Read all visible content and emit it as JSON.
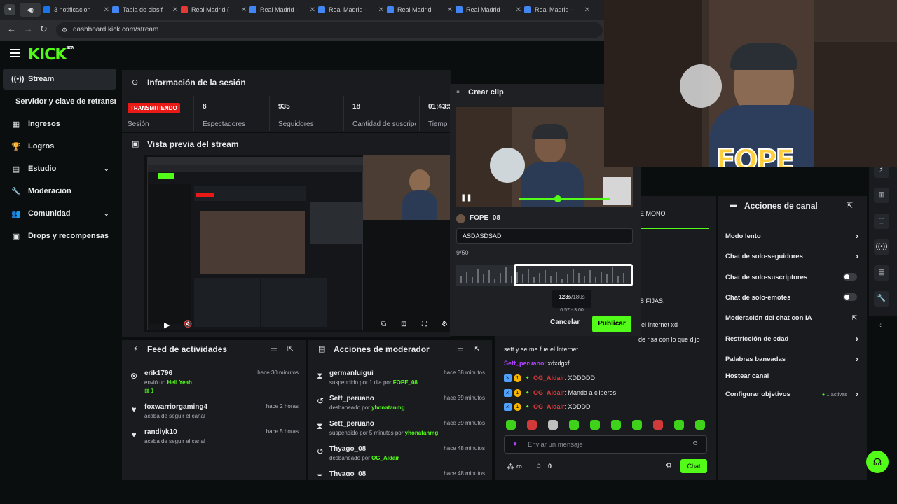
{
  "browser": {
    "tabs": [
      {
        "label": "3 notificacion",
        "color": "#1a73e8"
      },
      {
        "label": "Tabla de clasif",
        "color": "#4285f4"
      },
      {
        "label": "Real Madrid (",
        "color": "#e53935"
      },
      {
        "label": "Real Madrid -",
        "color": "#4285f4"
      },
      {
        "label": "Real Madrid -",
        "color": "#4285f4"
      },
      {
        "label": "Real Madrid -",
        "color": "#4285f4"
      },
      {
        "label": "Real Madrid -",
        "color": "#4285f4"
      },
      {
        "label": "Real Madrid -",
        "color": "#4285f4"
      }
    ],
    "url": "dashboard.kick.com/stream"
  },
  "header": {
    "logo": "KICK",
    "beta": "BETA"
  },
  "sidebar": {
    "items": [
      {
        "label": "Stream",
        "icon": "broadcast-icon"
      },
      {
        "label": "Servidor y clave de retransmisión",
        "icon": ""
      },
      {
        "label": "Ingresos",
        "icon": "chart-icon"
      },
      {
        "label": "Logros",
        "icon": "trophy-icon"
      },
      {
        "label": "Estudio",
        "icon": "layout-icon"
      },
      {
        "label": "Moderación",
        "icon": "wrench-icon"
      },
      {
        "label": "Comunidad",
        "icon": "people-icon"
      },
      {
        "label": "Drops y recompensas",
        "icon": "gift-icon"
      }
    ]
  },
  "session": {
    "title": "Información de la sesión",
    "status_badge": "TRANSMITIENDO",
    "status_label": "Sesión",
    "stats": [
      {
        "value": "8",
        "label": "Espectadores"
      },
      {
        "value": "935",
        "label": "Seguidores"
      },
      {
        "value": "18",
        "label": "Cantidad de suscripciones"
      },
      {
        "value": "01:43:5",
        "label": "Tiemp"
      }
    ]
  },
  "preview": {
    "title": "Vista previa del stream"
  },
  "activity": {
    "title": "Feed de actividades",
    "items": [
      {
        "icon": "kick-icon",
        "name": "erik1796",
        "time": "hace 30 minutos",
        "desc": "envió un",
        "highlight": "Hell Yeah",
        "extra": "1"
      },
      {
        "icon": "heart-icon",
        "name": "foxwarriorgaming4",
        "time": "hace 2 horas",
        "desc": "acaba de seguir el canal",
        "highlight": "",
        "extra": ""
      },
      {
        "icon": "heart-icon",
        "name": "randiyk10",
        "time": "hace 5 horas",
        "desc": "acaba de seguir el canal",
        "highlight": "",
        "extra": ""
      }
    ]
  },
  "mod_actions": {
    "title": "Acciones de moderador",
    "items": [
      {
        "icon": "hourglass-icon",
        "name": "germanluigui",
        "time": "hace 38 minutos",
        "desc": "suspendido por 1 día por",
        "by": "FOPE_08"
      },
      {
        "icon": "undo-icon",
        "name": "Sett_peruano",
        "time": "hace 39 minutos",
        "desc": "desbaneado por",
        "by": "yhonatanmg"
      },
      {
        "icon": "hourglass-icon",
        "name": "Sett_peruano",
        "time": "hace 39 minutos",
        "desc": "suspendido por 5 minutos por",
        "by": "yhonatanmg"
      },
      {
        "icon": "undo-icon",
        "name": "Thyago_08",
        "time": "hace 48 minutos",
        "desc": "desbaneado por",
        "by": "OG_Aldair"
      },
      {
        "icon": "hourglass-icon",
        "name": "Thyago_08",
        "time": "hace 48 minutos",
        "desc": "",
        "by": ""
      }
    ]
  },
  "clip": {
    "title": "Crear clip",
    "channel": "FOPE_08",
    "input_value": "ASDASDSAD",
    "char_count": "9/50",
    "duration": "123s",
    "duration_max": "/180s",
    "range": "0:57 - 3:00",
    "cancel": "Cancelar",
    "publish": "Publicar"
  },
  "chat": {
    "partial": [
      {
        "text": "E MONO"
      },
      {
        "text": "S FIJAS:"
      },
      {
        "text": "el Internet xd"
      },
      {
        "text": "de risa con lo que dijo"
      }
    ],
    "lines": [
      {
        "user": "",
        "text": "sett y se me fue el Internet"
      },
      {
        "user": "Sett_peruano",
        "text": "xdxdgxf"
      },
      {
        "user": "OG_Aldair",
        "text": "XDDDDD"
      },
      {
        "user": "OG_Aldair",
        "text": "Manda a cliperos"
      },
      {
        "user": "OG_Aldair",
        "text": "XDDDD"
      }
    ],
    "placeholder": "Enviar un mensaje",
    "viewer_count": "0",
    "send_button": "Chat"
  },
  "channel_actions": {
    "title": "Acciones de canal",
    "items": [
      {
        "label": "Modo lento",
        "control": "chevron"
      },
      {
        "label": "Chat de solo-seguidores",
        "control": "chevron"
      },
      {
        "label": "Chat de solo-suscriptores",
        "control": "toggle"
      },
      {
        "label": "Chat de solo-emotes",
        "control": "toggle"
      },
      {
        "label": "Moderación del chat con IA",
        "control": "external"
      },
      {
        "label": "Restricción de edad",
        "control": "chevron"
      },
      {
        "label": "Palabras baneadas",
        "control": "chevron"
      },
      {
        "label": "Hostear canal",
        "control": ""
      },
      {
        "label": "Configurar objetivos",
        "control": "chevron"
      }
    ],
    "objectives_active": "1 activas"
  },
  "overlay": {
    "brand_text": "FOPE"
  },
  "colors": {
    "accent": "#53fc18",
    "live": "#e91916",
    "panel": "#191b1f"
  }
}
